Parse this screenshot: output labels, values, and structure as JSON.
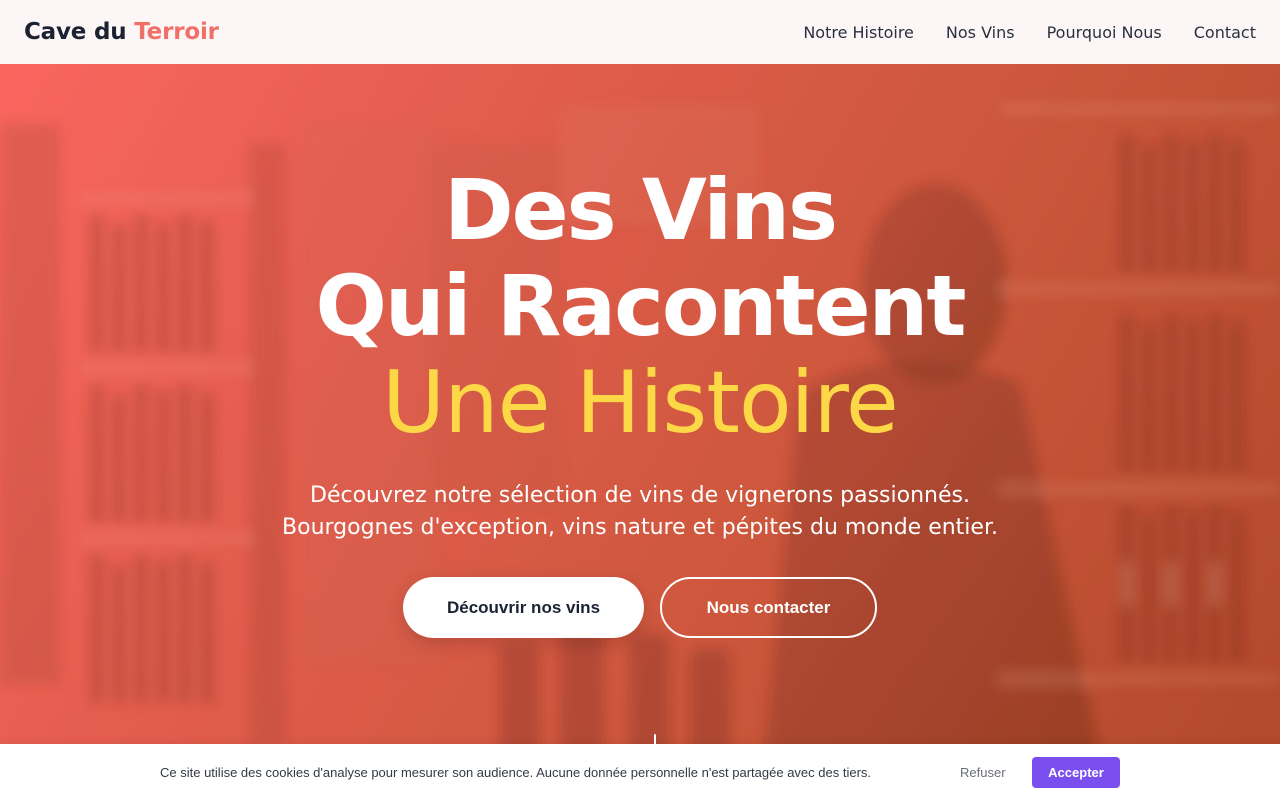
{
  "header": {
    "logo_main": "Cave du",
    "logo_accent": "Terroir",
    "nav": [
      {
        "label": "Notre Histoire"
      },
      {
        "label": "Nos Vins"
      },
      {
        "label": "Pourquoi Nous"
      },
      {
        "label": "Contact"
      }
    ]
  },
  "hero": {
    "title_line1": "Des Vins",
    "title_line2": "Qui Racontent",
    "title_line3": "Une Histoire",
    "subtitle_line1": "Découvrez notre sélection de vins de vignerons passionnés.",
    "subtitle_line2": "Bourgognes d'exception, vins nature et pépites du monde entier.",
    "primary_cta": "Découvrir nos vins",
    "secondary_cta": "Nous contacter"
  },
  "cookie": {
    "message": "Ce site utilise des cookies d'analyse pour mesurer son audience. Aucune donnée personnelle n'est partagée avec des tiers.",
    "refuse_label": "Refuser",
    "accept_label": "Accepter"
  },
  "colors": {
    "accent": "#f07068",
    "highlight": "#fcd846",
    "cookie_button": "#7b4ef0",
    "dark_text": "#1b2232"
  }
}
